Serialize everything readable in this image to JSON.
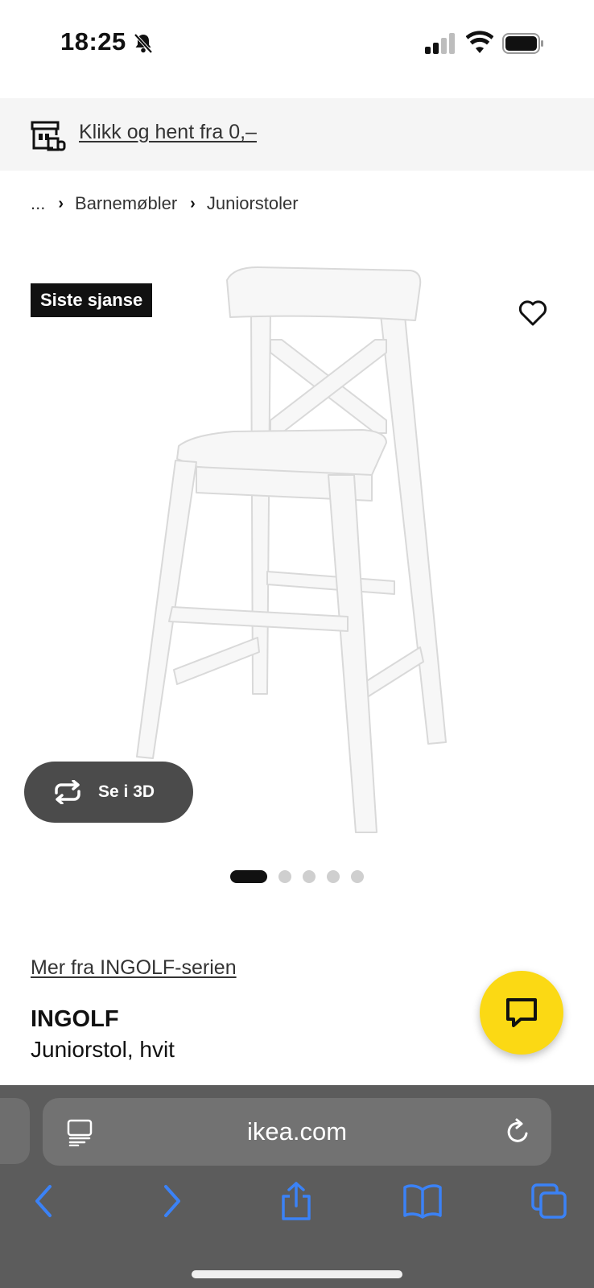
{
  "status_bar": {
    "time": "18:25"
  },
  "promo": {
    "text": "Klikk og hent fra 0,–",
    "icon": "store-pickup-icon"
  },
  "breadcrumb": {
    "ellipsis": "...",
    "items": [
      "Barnemøbler",
      "Juniorstoler"
    ]
  },
  "product": {
    "badge": "Siste sjanse",
    "view_3d_label": "Se i 3D",
    "image_count": 5,
    "active_image_index": 0,
    "series_link": "Mer fra INGOLF-serien",
    "name": "INGOLF",
    "description": "Juniorstol, hvit"
  },
  "browser": {
    "url": "ikea.com"
  },
  "colors": {
    "accent_yellow": "#fbd914",
    "badge_black": "#111111",
    "ios_blue": "#3b82f6",
    "browser_bar": "#5c5c5c"
  }
}
